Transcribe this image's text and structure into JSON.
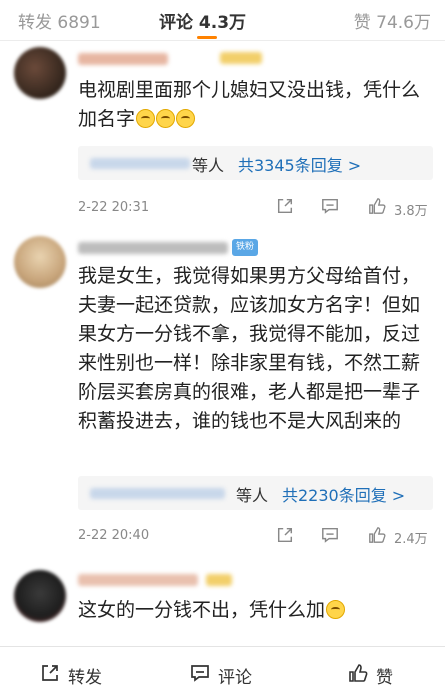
{
  "tabs": {
    "repost": "转发 6891",
    "comment": "评论 4.3万",
    "like": "赞 74.6万"
  },
  "comments": [
    {
      "text": "电视剧里面那个儿媳妇又没出钱，凭什么加名字",
      "reply_people": "等人",
      "reply_count": "共3345条回复 >",
      "time": "2-22 20:31",
      "likes": "3.8万"
    },
    {
      "badge": "铁粉",
      "text": "我是女生，我觉得如果男方父母给首付，夫妻一起还贷款，应该加女方名字！但如果女方一分钱不拿，我觉得不能加，反过来性别也一样！除非家里有钱，不然工薪阶层买套房真的很难，老人都是把一辈子积蓄投进去，谁的钱也不是大风刮来的",
      "reply_people": "等人",
      "reply_count": "共2230条回复 >",
      "time": "2-22 20:40",
      "likes": "2.4万"
    },
    {
      "text": "这女的一分钱不出，凭什么加"
    }
  ],
  "bottom_bar": {
    "repost": "转发",
    "comment": "评论",
    "like": "赞"
  }
}
